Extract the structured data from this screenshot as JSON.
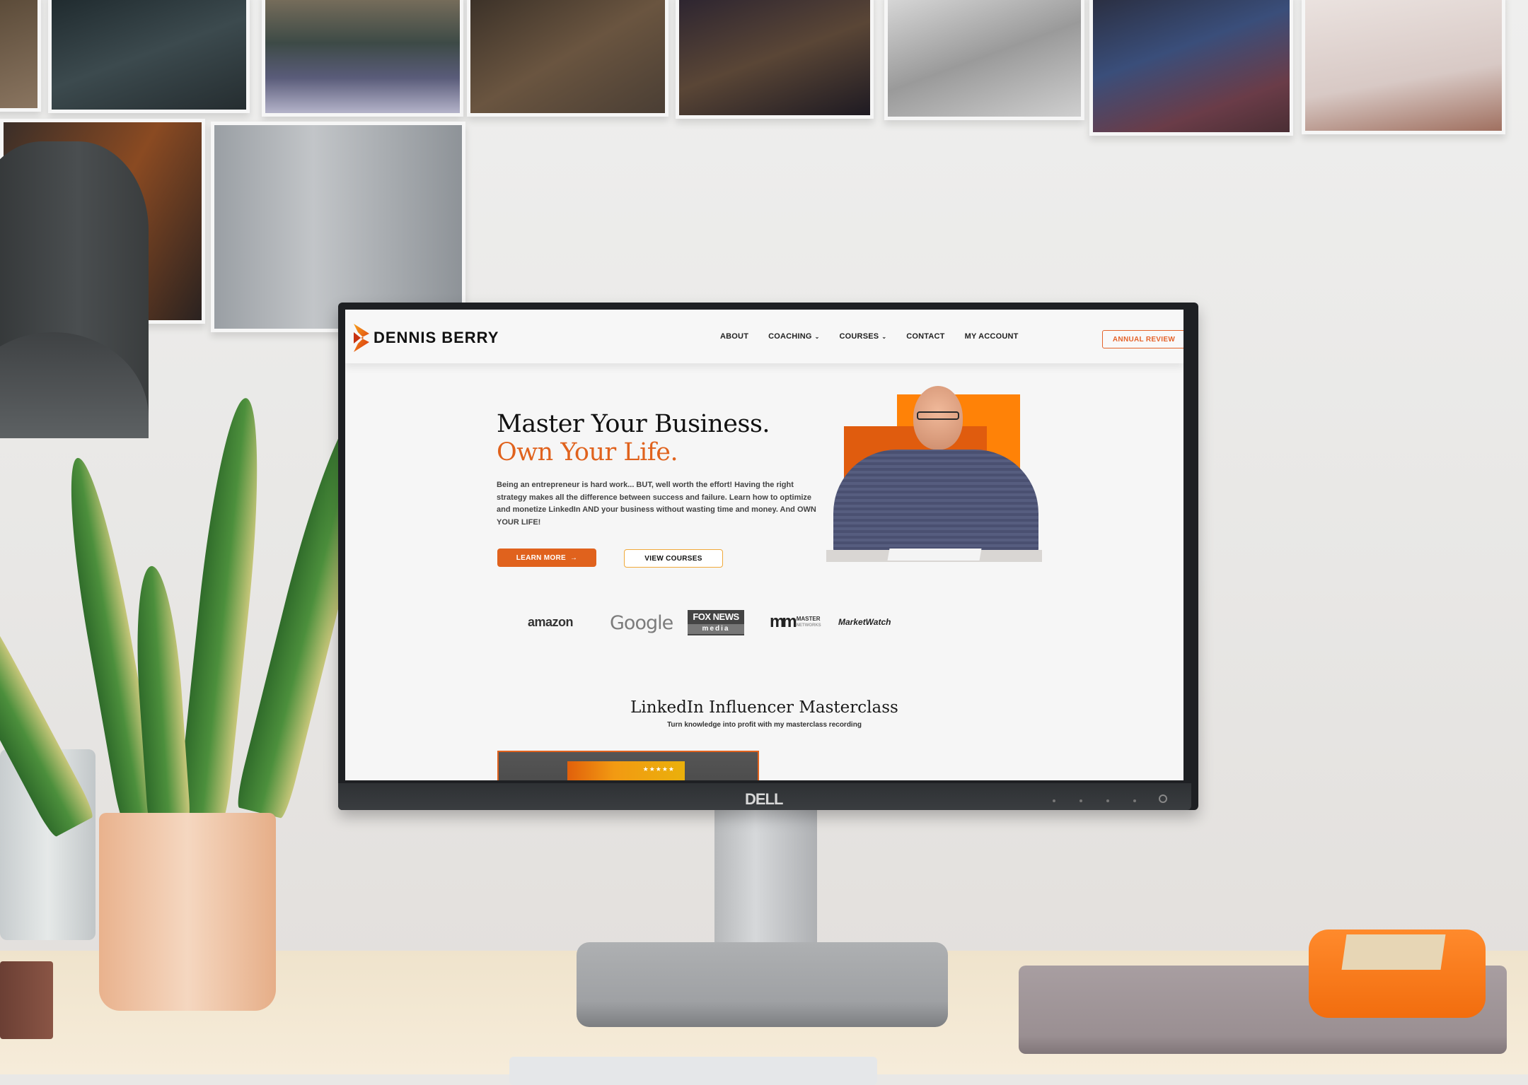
{
  "website": {
    "brand": {
      "name": "DENNIS BERRY",
      "logo_icon": "db-chevron-logo-icon"
    },
    "nav": {
      "items": [
        {
          "label": "ABOUT",
          "has_dropdown": false
        },
        {
          "label": "COACHING",
          "has_dropdown": true
        },
        {
          "label": "COURSES",
          "has_dropdown": true
        },
        {
          "label": "CONTACT",
          "has_dropdown": false
        },
        {
          "label": "MY ACCOUNT",
          "has_dropdown": false
        }
      ],
      "dropdown_icon": "chevron-down-icon",
      "dropdown_glyph": "⌄",
      "cta_label": "ANNUAL REVIEW"
    },
    "hero": {
      "title_line1": "Master Your Business.",
      "title_line2": "Own Your Life.",
      "body": "Being an entrepreneur is hard work... BUT, well worth the effort! Having the right strategy makes all the difference between success and failure. Learn how to optimize and monetize LinkedIn AND your business without wasting time and money. And OWN YOUR LIFE!",
      "primary_button": "LEARN MORE",
      "primary_button_icon": "→",
      "secondary_button": "VIEW COURSES"
    },
    "featured_logos": {
      "amazon": "amazon",
      "google": "Google",
      "fox_line1": "FOX NEWS",
      "fox_line2": "media",
      "master_mark": "mm",
      "master_line1": "MASTER",
      "master_line2": "NETWORKS",
      "marketwatch": "MarketWatch"
    },
    "masterclass": {
      "title": "LinkedIn Influencer Masterclass",
      "subtitle": "Turn knowledge into profit with my masterclass recording",
      "rating_stars": "★★★★★"
    },
    "colors": {
      "accent_orange": "#e0621d",
      "secondary_orange": "#ff8207",
      "outline_yellow": "#f0a93a",
      "text_dark": "#111111"
    }
  },
  "hardware": {
    "monitor_brand": "DELL"
  }
}
